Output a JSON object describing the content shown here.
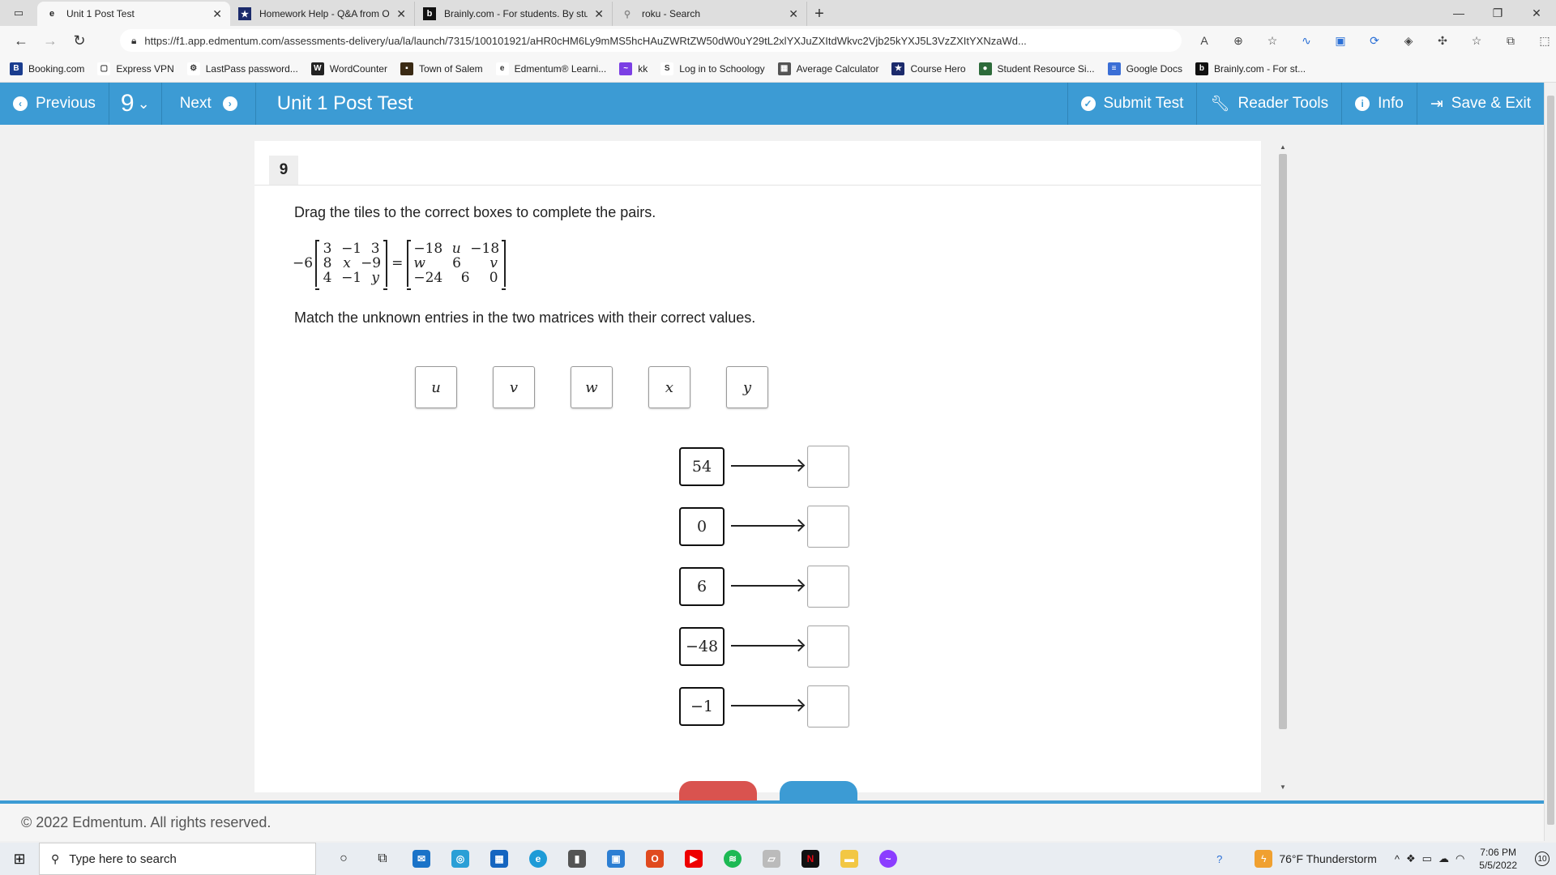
{
  "browser": {
    "tabs": [
      {
        "label": "Unit 1 Post Test",
        "icon": "edge-e-icon",
        "active": true
      },
      {
        "label": "Homework Help - Q&A from Onl",
        "icon": "star-icon",
        "active": false
      },
      {
        "label": "Brainly.com - For students. By stu",
        "icon": "brainly-icon",
        "active": false
      },
      {
        "label": "roku - Search",
        "icon": "search-icon",
        "active": false
      }
    ],
    "url": "https://f1.app.edmentum.com/assessments-delivery/ua/la/launch/7315/100101921/aHR0cHM6Ly9mMS5hcHAuZWRtZW50dW0uY29tL2xlYXJuZXItdWkvc2Vjb25kYXJ5L3VzZXItYXNzaWd...",
    "bookmarks": [
      {
        "label": "Booking.com",
        "color": "#1a3d8f",
        "glyph": "B"
      },
      {
        "label": "Express VPN",
        "color": "#ffffff",
        "glyph": "▢"
      },
      {
        "label": "LastPass password...",
        "color": "#ffffff",
        "glyph": "⚙"
      },
      {
        "label": "WordCounter",
        "color": "#222222",
        "glyph": "W"
      },
      {
        "label": "Town of Salem",
        "color": "#3a2a14",
        "glyph": "▪"
      },
      {
        "label": "Edmentum® Learni...",
        "color": "#ffffff",
        "glyph": "e"
      },
      {
        "label": "kk",
        "color": "#7b3fe4",
        "glyph": "~"
      },
      {
        "label": "Log in to Schoology",
        "color": "#ffffff",
        "glyph": "S"
      },
      {
        "label": "Average Calculator",
        "color": "#555555",
        "glyph": "▦"
      },
      {
        "label": "Course Hero",
        "color": "#1b2a6b",
        "glyph": "★"
      },
      {
        "label": "Student Resource Si...",
        "color": "#2d6b3a",
        "glyph": "●"
      },
      {
        "label": "Google Docs",
        "color": "#3b6fd6",
        "glyph": "≡"
      },
      {
        "label": "Brainly.com - For st...",
        "color": "#111111",
        "glyph": "b"
      }
    ]
  },
  "toolbar": {
    "previous_label": "Previous",
    "question_number": "9",
    "next_label": "Next",
    "title": "Unit 1 Post Test",
    "submit_label": "Submit Test",
    "reader_tools_label": "Reader Tools",
    "info_label": "Info",
    "save_exit_label": "Save & Exit"
  },
  "question": {
    "number": "9",
    "instruction": "Drag the tiles to the correct boxes to complete the pairs.",
    "scalar": "−6",
    "left_matrix": [
      [
        "3",
        "−1",
        "3"
      ],
      [
        "8",
        "x",
        "−9"
      ],
      [
        "4",
        "−1",
        "y"
      ]
    ],
    "right_matrix": [
      [
        "−18",
        "u",
        "−18"
      ],
      [
        "w",
        "6",
        "v"
      ],
      [
        "−24",
        "6",
        "0"
      ]
    ],
    "match_text": "Match the unknown entries in the two matrices with their correct values.",
    "tiles": [
      "u",
      "v",
      "w",
      "x",
      "y"
    ],
    "pair_values": [
      "54",
      "0",
      "6",
      "−48",
      "−1"
    ]
  },
  "footer": {
    "copyright": "© 2022 Edmentum. All rights reserved."
  },
  "taskbar": {
    "search_placeholder": "Type here to search",
    "weather": "76°F  Thunderstorm",
    "time": "7:06 PM",
    "date": "5/5/2022",
    "notifications": "10"
  }
}
